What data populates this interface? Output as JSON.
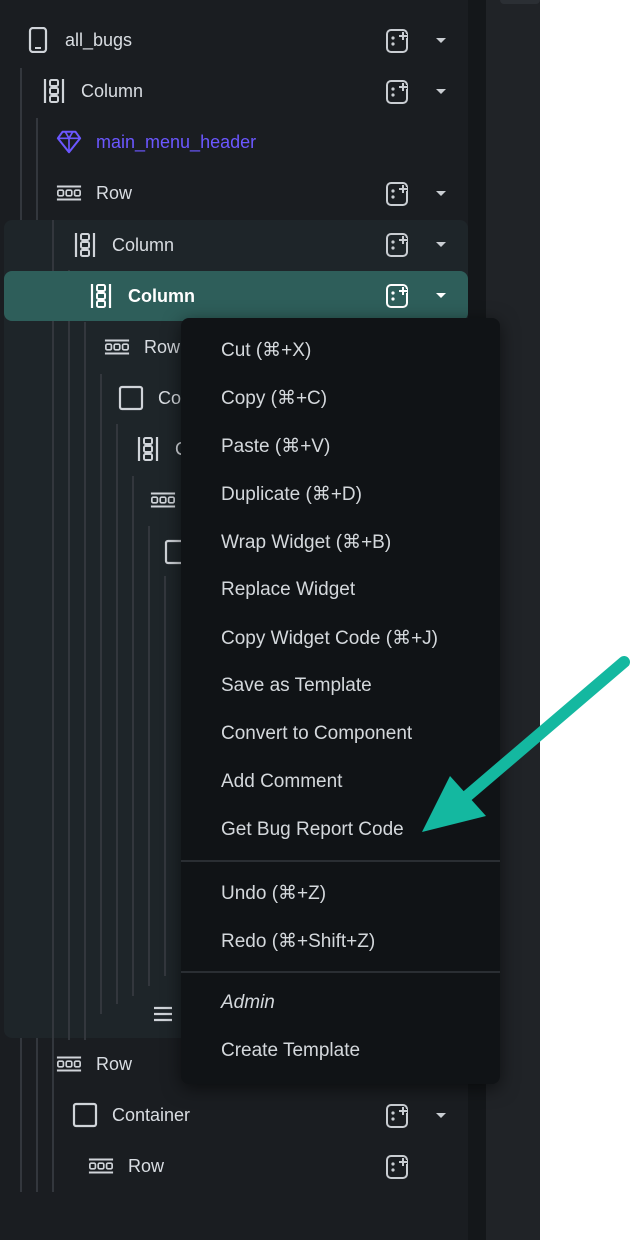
{
  "tree": {
    "items": [
      {
        "label": "all_bugs",
        "icon": "phone-icon"
      },
      {
        "label": "Column",
        "icon": "column-icon"
      },
      {
        "label": "main_menu_header",
        "icon": "diamond-icon"
      },
      {
        "label": "Row",
        "icon": "row-icon"
      },
      {
        "label": "Column",
        "icon": "column-icon"
      },
      {
        "label": "Column",
        "icon": "column-icon",
        "selected": true
      },
      {
        "label": "Row",
        "icon": "row-icon"
      },
      {
        "label": "Co",
        "icon": "container-icon"
      },
      {
        "label": "C",
        "icon": "column-icon"
      },
      {
        "label": "",
        "icon": "row-icon"
      },
      {
        "label": "",
        "icon": "container-icon"
      },
      {
        "label": "",
        "icon": "list-icon"
      },
      {
        "label": "Row",
        "icon": "row-icon"
      },
      {
        "label": "Container",
        "icon": "container-icon"
      },
      {
        "label": "Row",
        "icon": "row-icon"
      }
    ]
  },
  "context_menu": {
    "items": [
      "Cut (⌘+X)",
      "Copy (⌘+C)",
      "Paste (⌘+V)",
      "Duplicate (⌘+D)",
      "Wrap Widget (⌘+B)",
      "Replace Widget",
      "Copy Widget Code (⌘+J)",
      "Save as Template",
      "Convert to Component",
      "Add Comment",
      "Get Bug Report Code",
      "Undo (⌘+Z)",
      "Redo (⌘+Shift+Z)",
      "Admin",
      "Create Template"
    ]
  },
  "colors": {
    "panel_bg": "#1a1d21",
    "selected_bg": "#2e5e5a",
    "accent_purple": "#6b57ff",
    "arrow": "#14b8a0"
  }
}
